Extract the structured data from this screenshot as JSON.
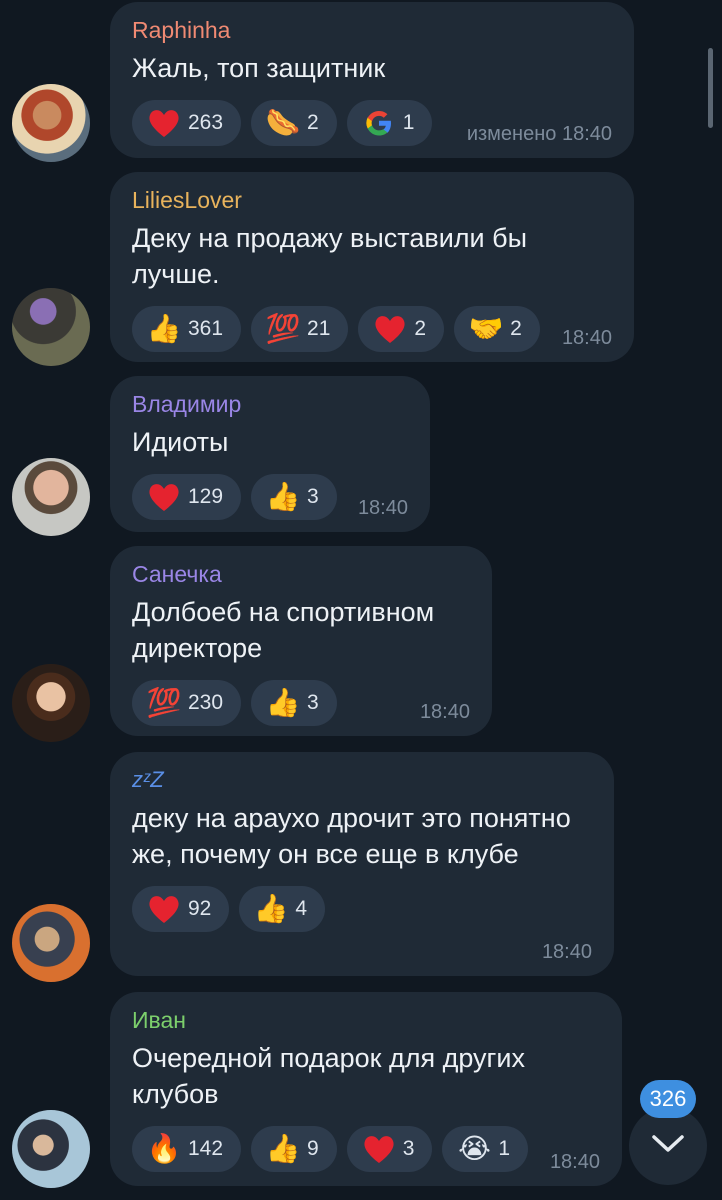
{
  "messages": [
    {
      "name": "Raphinha",
      "name_color": "#f08a73",
      "text": "Жаль, топ защитник",
      "meta": "изменено 18:40",
      "reactions": [
        {
          "icon": "heart",
          "count": "263"
        },
        {
          "icon": "hotdog",
          "count": "2"
        },
        {
          "icon": "google-g",
          "count": "1"
        }
      ]
    },
    {
      "name": "LiliesLover",
      "name_color": "#e8b35c",
      "text": "Деку на продажу выставили бы лучше.",
      "meta": "18:40",
      "reactions": [
        {
          "icon": "thumbs-up",
          "count": "361"
        },
        {
          "icon": "hundred",
          "count": "21"
        },
        {
          "icon": "heart",
          "count": "2"
        },
        {
          "icon": "handshake",
          "count": "2"
        }
      ]
    },
    {
      "name": "Владимир",
      "name_color": "#9a86e6",
      "text": "Идиоты",
      "meta": "18:40",
      "reactions": [
        {
          "icon": "heart",
          "count": "129"
        },
        {
          "icon": "thumbs-up",
          "count": "3"
        }
      ]
    },
    {
      "name": "Санечка",
      "name_color": "#9a86e6",
      "text": "Долбоеб на спортивном директоре",
      "meta": "18:40",
      "reactions": [
        {
          "icon": "hundred",
          "count": "230"
        },
        {
          "icon": "thumbs-up",
          "count": "3"
        }
      ]
    },
    {
      "name": "zᶻZ",
      "name_color": "#5a8fe6",
      "text": "деку на араухо дрочит это понятно же, почему он все еще в клубе",
      "meta": "18:40",
      "reactions": [
        {
          "icon": "heart",
          "count": "92"
        },
        {
          "icon": "thumbs-up",
          "count": "4"
        }
      ]
    },
    {
      "name": "Иван",
      "name_color": "#7ccf6c",
      "text": "Очередной подарок для других клубов",
      "meta": "18:40",
      "reactions": [
        {
          "icon": "fire",
          "count": "142"
        },
        {
          "icon": "thumbs-up",
          "count": "9"
        },
        {
          "icon": "heart",
          "count": "3"
        },
        {
          "icon": "crying-face",
          "count": "1"
        }
      ]
    }
  ],
  "unread_badge": "326",
  "colors": {
    "background": "#101821",
    "bubble": "#1f2a36",
    "reaction": "#2e3c4d",
    "accent": "#3e8fe0"
  }
}
